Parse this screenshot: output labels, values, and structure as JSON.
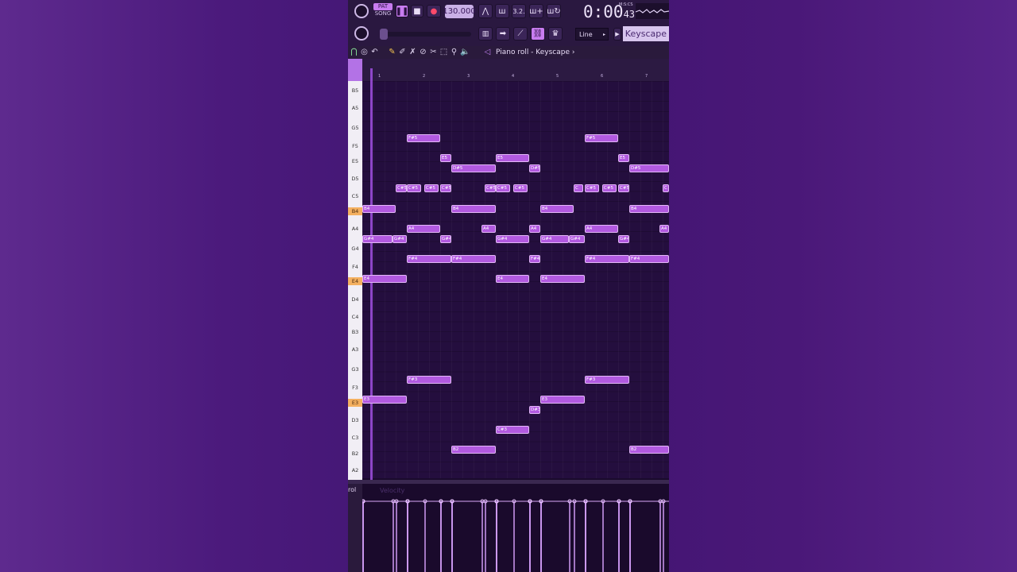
{
  "toolbar": {
    "pat_label": "PAT",
    "song_label": "SONG",
    "tempo": "130.000",
    "time_main": "0:00",
    "time_sub": "43",
    "time_unit": "M:S:CS",
    "snap": "Line",
    "channel": "Keyscape"
  },
  "piano_roll": {
    "title": "Piano roll - Keyscape",
    "bar_numbers": [
      "1",
      "2",
      "3",
      "4",
      "5",
      "6",
      "7"
    ],
    "keys": [
      "B5",
      "A5",
      "G5",
      "F5",
      "E5",
      "D5",
      "C5",
      "B4",
      "A4",
      "G4",
      "F4",
      "E4",
      "D4",
      "C4",
      "B3",
      "A3",
      "G3",
      "F3",
      "E3",
      "D3",
      "C3",
      "B2",
      "A2"
    ],
    "highlighted_keys": [
      "B4",
      "E4",
      "E3"
    ],
    "notes": [
      "F#5",
      "E5",
      "D#5",
      "E5",
      "D#5",
      "F#5",
      "E5",
      "D#5",
      "C#5",
      "C#5",
      "C#5",
      "C#5",
      "C#5",
      "C#5",
      "C#5",
      "C",
      "C#5",
      "C#5",
      "C#5",
      "C",
      "B4",
      "B4",
      "B4",
      "B4",
      "A4",
      "A4",
      "A4",
      "A4",
      "A4",
      "G#4",
      "G#4",
      "G#4",
      "G#4",
      "G#4",
      "G#4",
      "G#4",
      "F#4",
      "F#4",
      "F#4",
      "F#4",
      "F#4",
      "E4",
      "E4",
      "E4",
      "F#3",
      "F#3",
      "E3",
      "E3",
      "D#3",
      "C#3",
      "B2",
      "B2"
    ]
  },
  "controller": {
    "label": "rol",
    "target": "Velocity"
  },
  "colors": {
    "background": "#4b1a7c",
    "note": "#b25ae0",
    "accent": "#c87cf0",
    "key_highlight": "#f4b060"
  }
}
